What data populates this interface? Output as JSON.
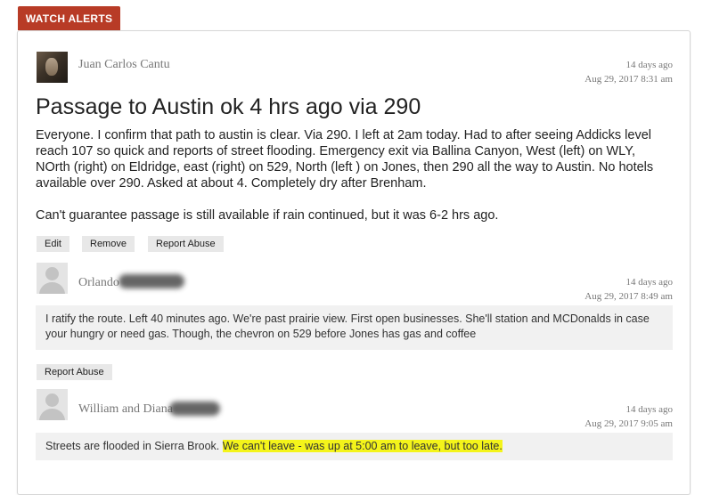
{
  "tab": {
    "label": "WATCH ALERTS"
  },
  "post": {
    "author": "Juan Carlos Cantu",
    "ago": "14 days ago",
    "date": "Aug 29, 2017 8:31 am",
    "title": "Passage to Austin ok 4 hrs ago via 290",
    "paragraph1": "Everyone. I confirm that path to austin is clear. Via 290. I left at 2am today. Had to after seeing Addicks level reach 107 so quick and reports of street flooding. Emergency exit via Ballina Canyon, West (left) on WLY, NOrth (right) on Eldridge, east (right) on 529, North (left ) on Jones, then 290 all the way to Austin. No hotels available over 290. Asked at about 4. Completely dry after Brenham.",
    "paragraph2": "Can't guarantee passage is still available if rain continued, but it was 6-2 hrs ago.",
    "edit_label": "Edit",
    "remove_label": "Remove",
    "report_label": "Report Abuse"
  },
  "comments": [
    {
      "author": "Orlando",
      "ago": "14 days ago",
      "date": "Aug 29, 2017 8:49 am",
      "text": "I ratify the route. Left 40 minutes ago. We're past prairie view. First open businesses. She'll station and MCDonalds in case your hungry or need gas. Though, the chevron on 529 before Jones has gas and coffee",
      "report_label": "Report Abuse"
    },
    {
      "author": "William and Diana",
      "ago": "14 days ago",
      "date": "Aug 29, 2017 9:05 am",
      "text_plain": "Streets are flooded in Sierra Brook. ",
      "text_highlight": "We can't leave - was up at 5:00 am to leave, but too late."
    }
  ],
  "colors": {
    "tab": "#b83b26",
    "highlight": "#f4f41a",
    "comment_bg": "#f1f1f1"
  }
}
